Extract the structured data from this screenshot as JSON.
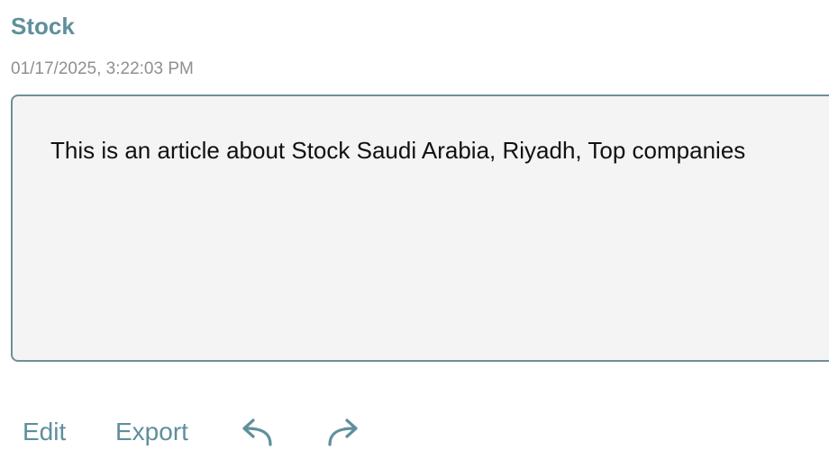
{
  "article": {
    "title": "Stock",
    "timestamp": "01/17/2025, 3:22:03 PM",
    "body": "This is an article about Stock Saudi Arabia, Riyadh, Top companies"
  },
  "toolbar": {
    "edit_label": "Edit",
    "export_label": "Export",
    "undo_icon": "undo-icon",
    "redo_icon": "redo-icon"
  },
  "colors": {
    "accent": "#5f8f9c",
    "box_border": "#6d8f98",
    "box_background": "#f4f4f4",
    "timestamp": "#8f8f8f"
  }
}
